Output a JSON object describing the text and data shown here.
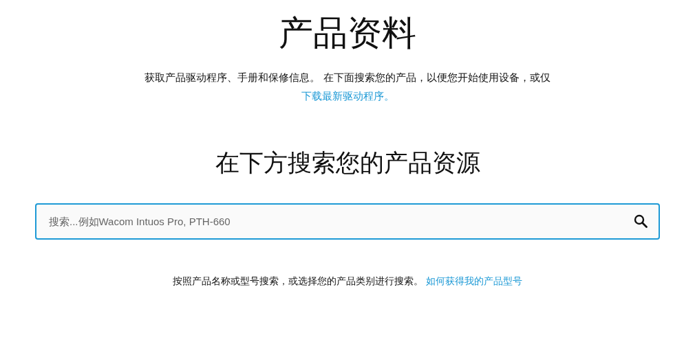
{
  "page_title": "产品资料",
  "intro": {
    "text": "获取产品驱动程序、手册和保修信息。 在下面搜索您的产品，以便您开始使用设备，或仅",
    "link": "下载最新驱动程序。"
  },
  "search_heading": "在下方搜索您的产品资源",
  "search": {
    "placeholder": "搜索...例如Wacom Intuos Pro, PTH-660"
  },
  "hint": {
    "text": "按照产品名称或型号搜索，或选择您的产品类别进行搜索。 ",
    "link": "如何获得我的产品型号"
  }
}
